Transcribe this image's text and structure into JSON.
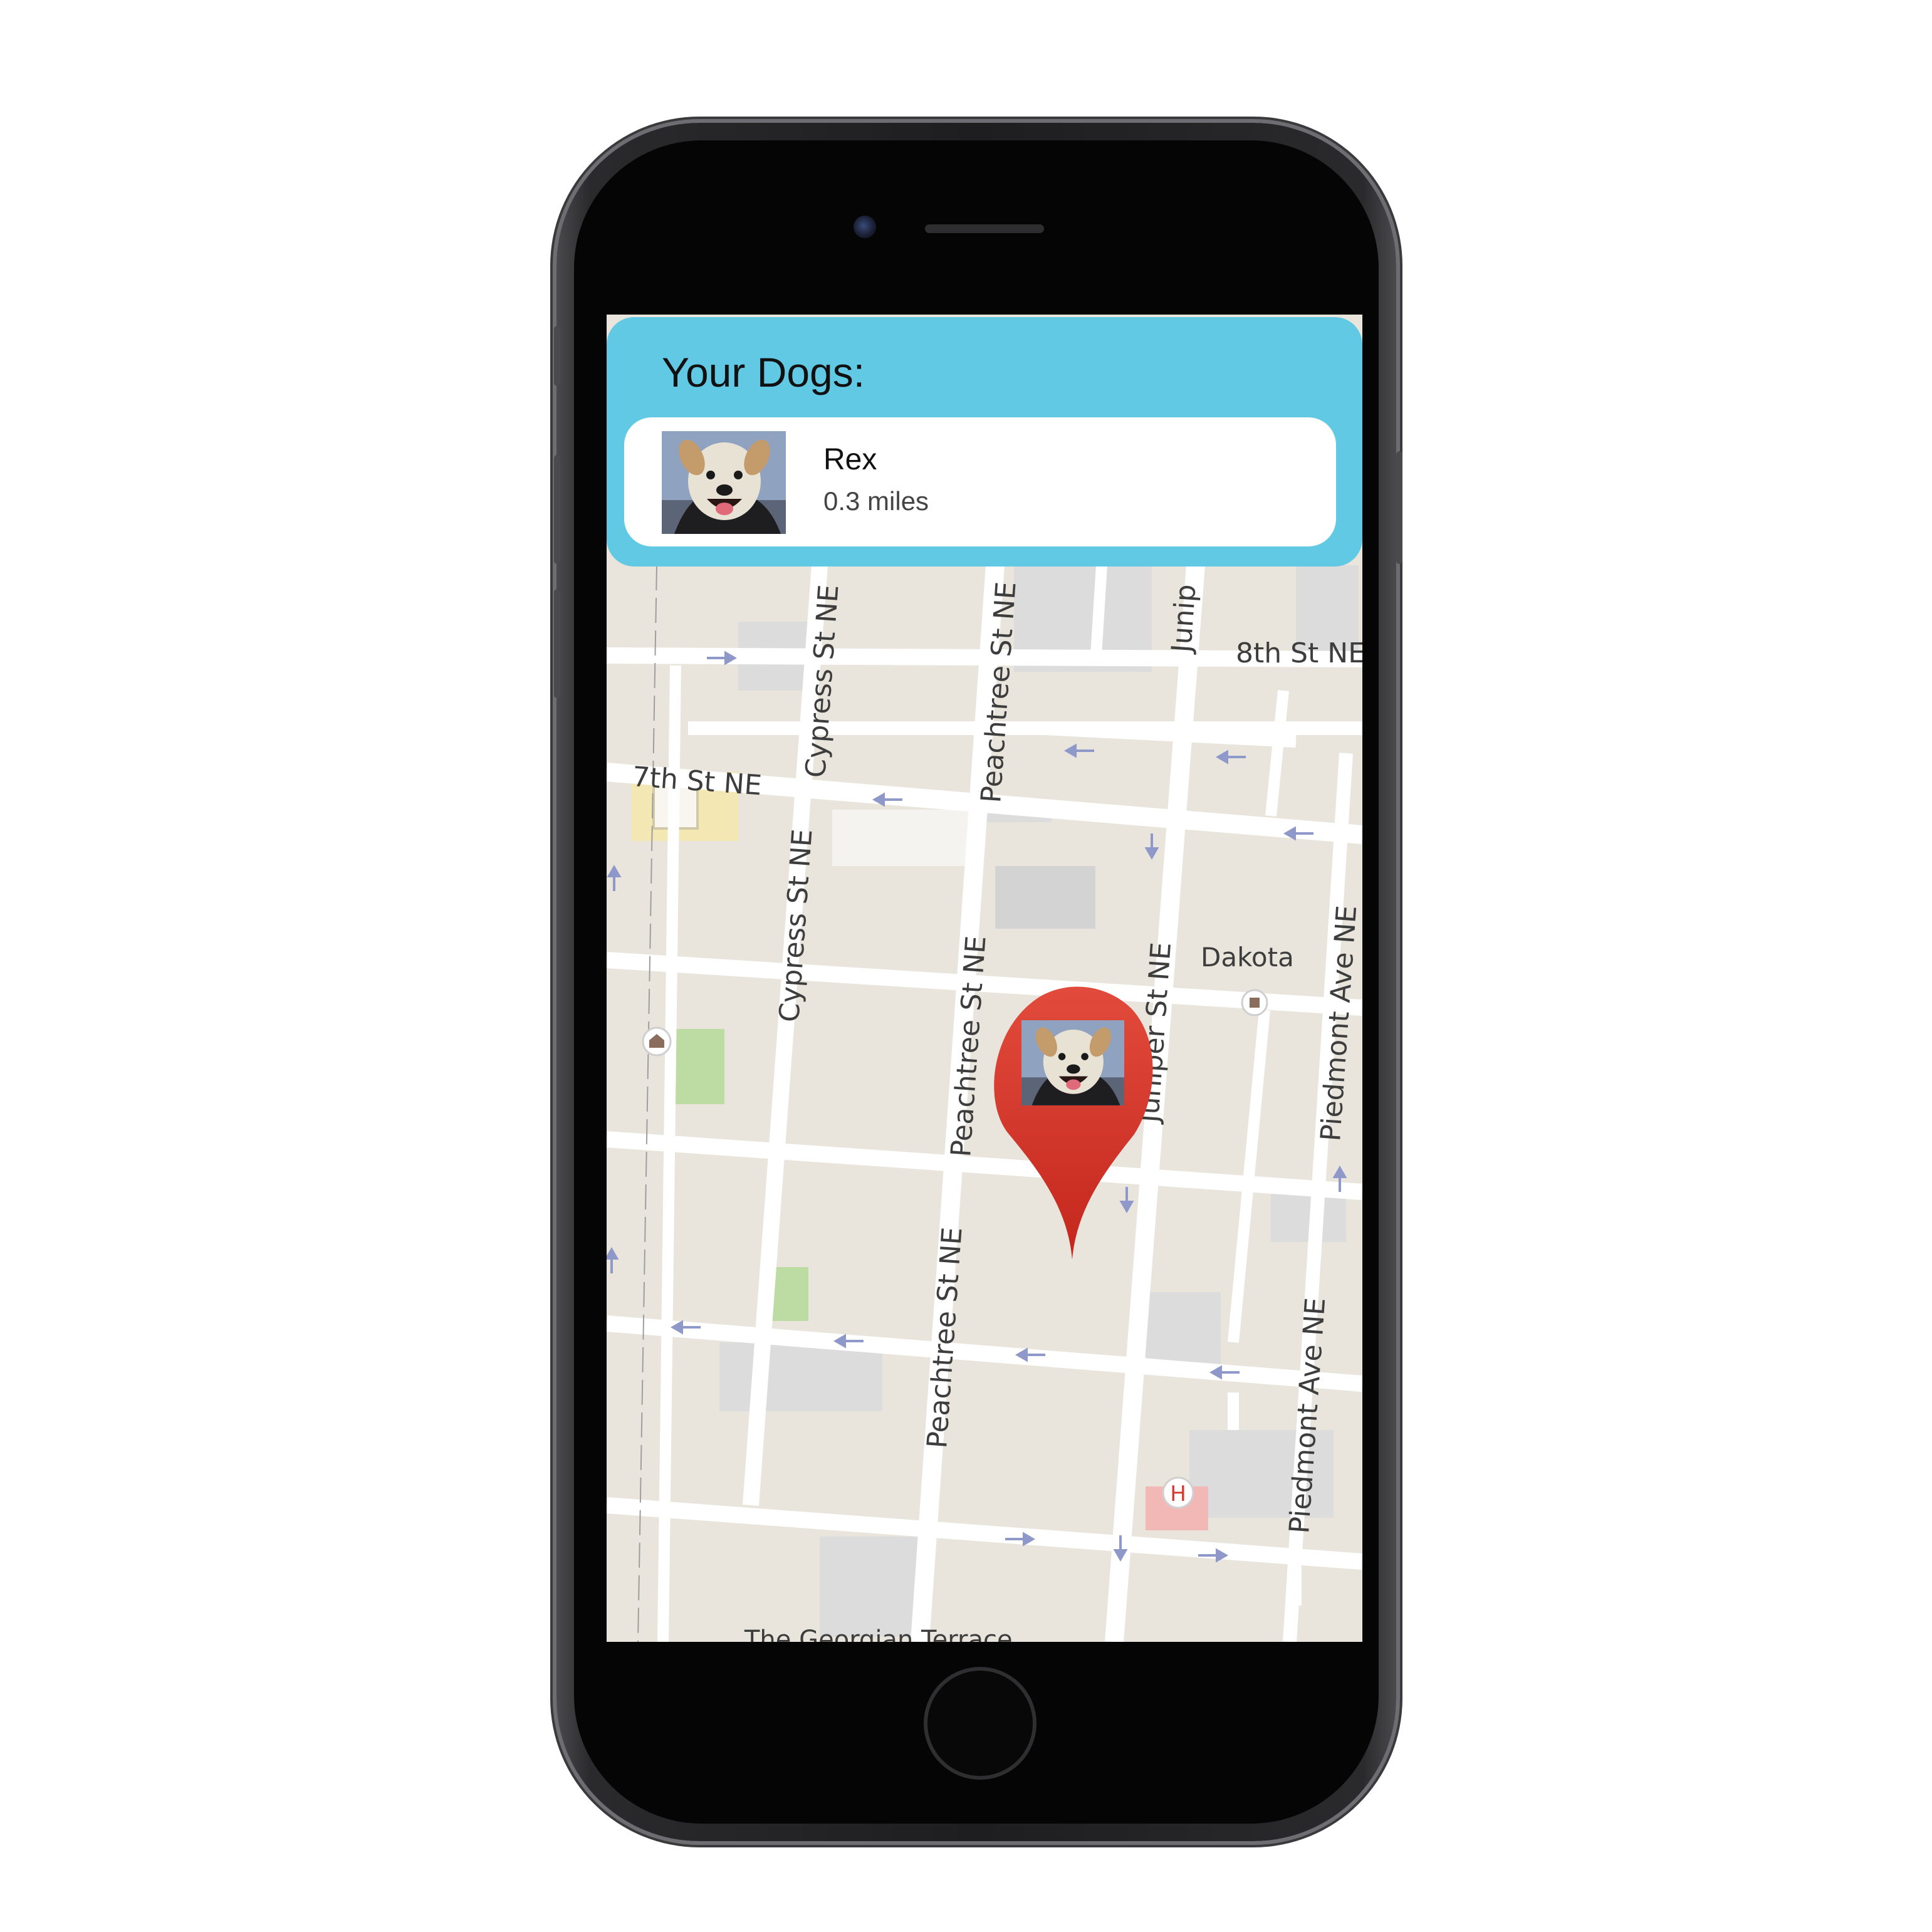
{
  "app": {
    "panel_title": "Your Dogs:",
    "accent_color": "#61c9e4",
    "pin_color": "#d63a2f"
  },
  "dogs": [
    {
      "name": "Rex",
      "distance": "0.3 miles",
      "photo_icon": "dog-photo"
    }
  ],
  "map": {
    "streets": {
      "cypress_upper": "Cypress St NE",
      "cypress_lower": "Cypress St NE",
      "peachtree_upper": "Peachtree St NE",
      "peachtree_mid": "Peachtree St NE",
      "peachtree_lower": "Peachtree St NE",
      "juniper_upper": "Junip",
      "juniper_mid": "Juniper St NE",
      "eighth": "8th St NE",
      "seventh": "7th St NE",
      "piedmont_upper": "Piedmont Ave NE",
      "piedmont_lower": "Piedmont Ave NE"
    },
    "places": {
      "dakota": "Dakota",
      "georgian": "The Georgian Terrace",
      "hospital_letter": "H"
    }
  }
}
